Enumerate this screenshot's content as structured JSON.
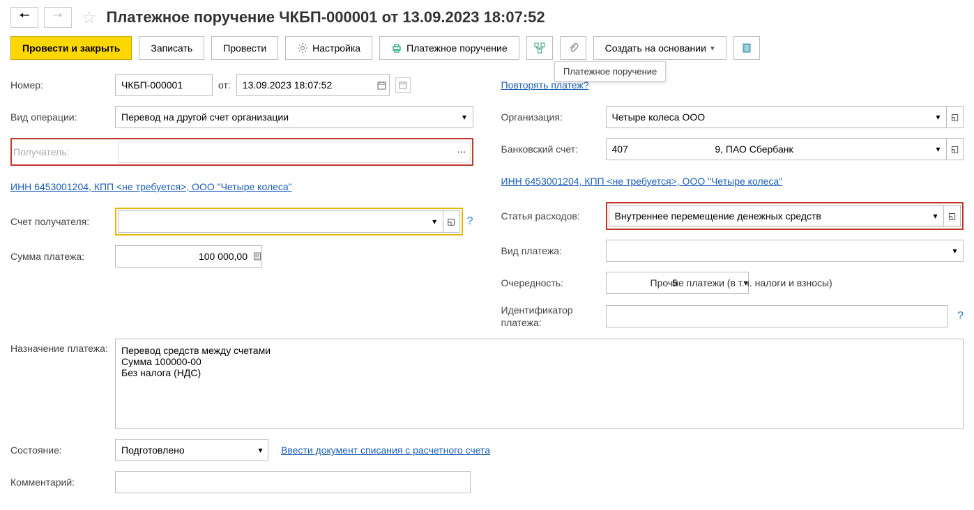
{
  "title": "Платежное поручение ЧКБП-000001 от 13.09.2023 18:07:52",
  "toolbar": {
    "post_close": "Провести и закрыть",
    "save": "Записать",
    "post": "Провести",
    "settings": "Настройка",
    "print": "Платежное поручение",
    "create_based": "Создать на основании"
  },
  "tooltip": "Платежное поручение",
  "left": {
    "number_label": "Номер:",
    "number": "ЧКБП-000001",
    "from_label": "от:",
    "date": "13.09.2023 18:07:52",
    "op_type_label": "Вид операции:",
    "op_type": "Перевод на другой счет организации",
    "recipient_label": "Получатель:",
    "recipient": "",
    "inn_link": "ИНН 6453001204, КПП <не требуется>, ООО \"Четыре колеса\"",
    "recipient_account_label": "Счет получателя:",
    "recipient_account": "",
    "amount_label": "Сумма платежа:",
    "amount": "100 000,00"
  },
  "right": {
    "repeat_link": "Повторять платеж?",
    "org_label": "Организация:",
    "org": "Четыре колеса ООО",
    "bank_account_label": "Банковский счет:",
    "bank_account": "407                                9, ПАО Сбербанк",
    "inn_link": "ИНН 6453001204, КПП <не требуется>, ООО \"Четыре колеса\"",
    "expense_label": "Статья расходов:",
    "expense": "Внутреннее перемещение денежных средств",
    "payment_type_label": "Вид платежа:",
    "payment_type": "",
    "priority_label": "Очередность:",
    "priority": "5",
    "priority_desc": "Прочие платежи (в т.ч. налоги и взносы)",
    "identifier_label": "Идентификатор платежа:",
    "identifier": ""
  },
  "purpose_label": "Назначение платежа:",
  "purpose": "Перевод средств между счетами\nСумма 100000-00\nБез налога (НДС)",
  "status_label": "Состояние:",
  "status": "Подготовлено",
  "write_off_link": "Ввести документ списания с расчетного счета",
  "comment_label": "Комментарий:",
  "comment": ""
}
